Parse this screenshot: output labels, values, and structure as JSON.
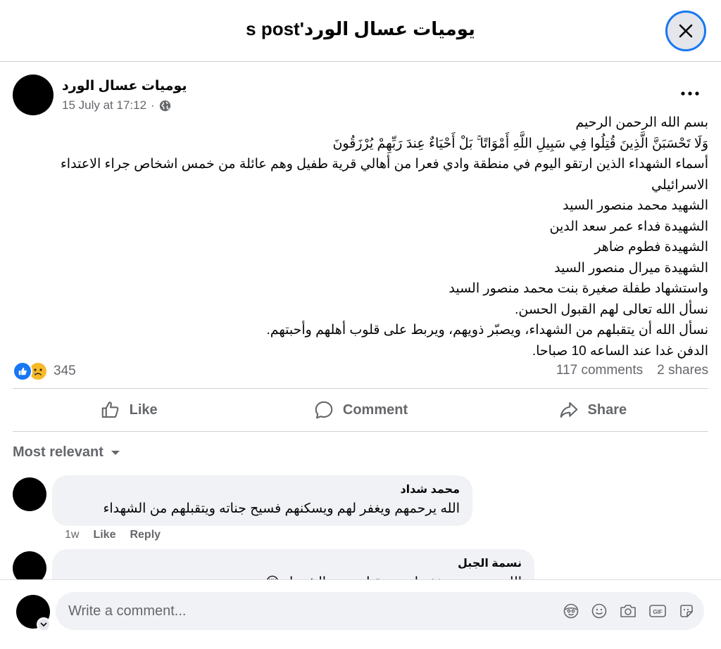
{
  "header": {
    "title": "يوميات عسال الورد's post"
  },
  "post": {
    "author": "يوميات عسال الورد",
    "timestamp": "15 July at 17:12",
    "separator": "·",
    "body": [
      "بسم الله الرحمن الرحيم",
      "وَلَا تَحْسَبَنَّ الَّذِينَ قُتِلُوا فِي سَبِيلِ اللَّهِ أَمْوَاتًا ۚ بَلْ أَحْيَاءٌ عِندَ رَبِّهِمْ يُرْزَقُونَ",
      "أسماء الشهداء الذين ارتقو اليوم في منطقة وادي فعرا من أهالي قرية طفيل وهم عائلة من خمس اشخاص جراء الاعتداء الاسرائيلي",
      "الشهيد محمد منصور السيد",
      "الشهيدة فداء عمر سعد الدين",
      "الشهيدة فطوم ضاهر",
      "الشهيدة ميرال منصور السيد",
      "واستشهاد طفلة صغيرة بنت محمد منصور السيد",
      "نسأل الله تعالى لهم القبول الحسن.",
      "نسأل الله أن يتقبلهم من الشهداء، ويصبّر ذويهم، ويربط على قلوب أهلهم وأحبتهم.",
      "الدفن غدا عند الساعه 10 صباحا."
    ],
    "reaction_count": "345",
    "comments_count": "117 comments",
    "shares_count": "2 shares"
  },
  "actions": {
    "like": "Like",
    "comment": "Comment",
    "share": "Share"
  },
  "sort": {
    "label": "Most relevant"
  },
  "comments": [
    {
      "name": "محمد شداد",
      "text": "الله يرحمهم ويغفر لهم ويسكنهم فسيح جناته ويتقبلهم من الشهداء",
      "age": "1w",
      "like": "Like",
      "reply": "Reply"
    },
    {
      "name": "نسمة الجبل",
      "text": "الله يرحمهم ويغفر لهم ويتقبلهم من الشهداء 😢"
    }
  ],
  "composer": {
    "placeholder": "Write a comment..."
  },
  "colors": {
    "accent": "#1877f2",
    "muted": "#65676b",
    "bubble": "#f0f2f5",
    "divider": "#ced0d4"
  }
}
